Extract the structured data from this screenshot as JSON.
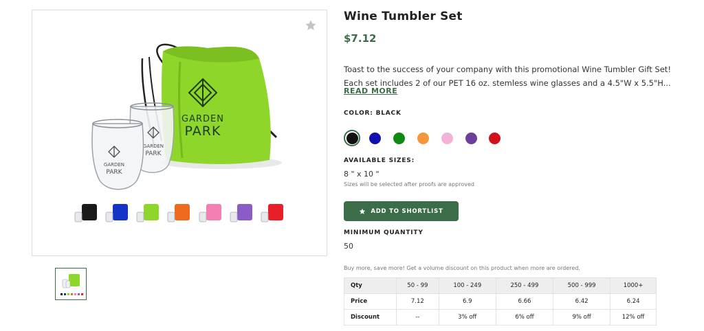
{
  "product": {
    "title": "Wine Tumbler Set",
    "price": "$7.12",
    "description_line1": "Toast to the success of your company with this promotional Wine Tumbler Gift Set!",
    "description_line2": "Each set includes 2 of our PET 16 oz. stemless wine glasses and a 4.5\"W x 5.5\"H...",
    "read_more": "READ MORE",
    "image_text": {
      "brand_top": "GARDEN",
      "brand_bottom": "PARK"
    }
  },
  "colors": {
    "label": "COLOR: BLACK",
    "selected_index": 0,
    "swatches": [
      {
        "name": "Black",
        "hex": "#111111"
      },
      {
        "name": "Blue",
        "hex": "#1010b0"
      },
      {
        "name": "Green",
        "hex": "#108a10"
      },
      {
        "name": "Orange",
        "hex": "#f4963c"
      },
      {
        "name": "Pink",
        "hex": "#f2b3d6"
      },
      {
        "name": "Purple",
        "hex": "#6c3f9b"
      },
      {
        "name": "Red",
        "hex": "#d3101a"
      }
    ]
  },
  "sizes": {
    "label": "AVAILABLE SIZES:",
    "value": "8 \" x 10 \"",
    "note": "Sizes will be selected after proofs are approved"
  },
  "shortlist": {
    "label": "ADD TO SHORTLIST",
    "icon": "star-icon"
  },
  "minimum_quantity": {
    "label": "MINIMUM QUANTITY",
    "value": "50"
  },
  "volume_note": "Buy more, save more! Get a volume discount on this product when more are ordered.",
  "pricing_table": {
    "headers": [
      "Qty",
      "50 - 99",
      "100 - 249",
      "250 - 499",
      "500 - 999",
      "1000+"
    ],
    "price_row": [
      "Price",
      "7.12",
      "6.9",
      "6.66",
      "6.42",
      "6.24"
    ],
    "discount_row": [
      "Discount",
      "--",
      "3% off",
      "6% off",
      "9% off",
      "12% off"
    ]
  },
  "theme": {
    "accent": "#3b6e48",
    "bag_green": "#8fd62b"
  }
}
